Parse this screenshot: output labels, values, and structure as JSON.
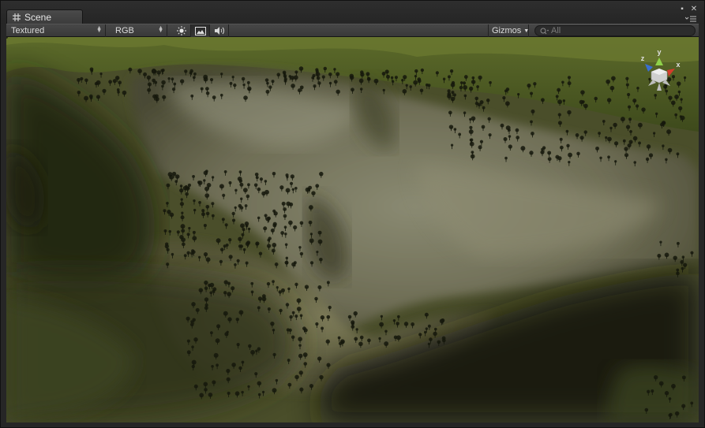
{
  "tab": {
    "title": "Scene",
    "icon": "grid-icon"
  },
  "toolbar": {
    "draw_mode": "Textured",
    "render_mode": "RGB",
    "lighting_icon": "sun-icon",
    "fx_icon": "image-icon",
    "audio_icon": "speaker-icon",
    "gizmos_label": "Gizmos",
    "search_placeholder": "All"
  },
  "gizmo_axes": {
    "y": "y",
    "x": "x",
    "z": "z"
  },
  "colors": {
    "y_axis": "#8fd24a",
    "x_axis": "#d43c2c",
    "z_axis": "#3a6fd0",
    "window_bg": "#262626",
    "toolbar_bg": "#3f3f3f"
  }
}
